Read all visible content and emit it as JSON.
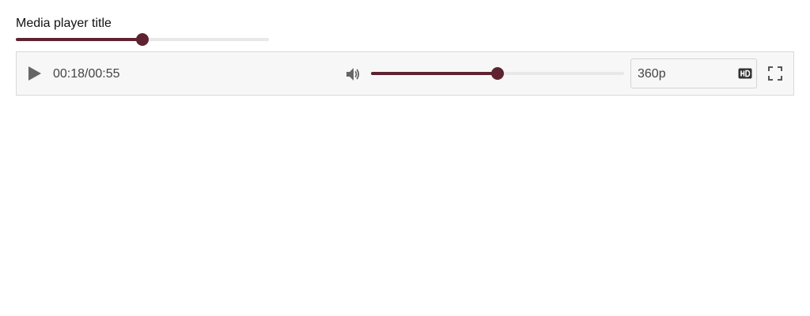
{
  "title": "Media player title",
  "colors": {
    "accent": "#5e2230",
    "track": "#e8e8e8",
    "icon": "#666666",
    "bar_bg": "#f7f7f7",
    "border": "#d9d9d9"
  },
  "seek": {
    "value": 0.5
  },
  "player": {
    "play_icon": "play-icon",
    "current_time": "00:18",
    "separator": "/",
    "duration": "00:55",
    "volume_icon": "volume-icon",
    "volume": {
      "value": 0.5
    },
    "quality": {
      "value": "360p",
      "icon": "hd-icon"
    },
    "fullscreen_icon": "fullscreen-icon"
  }
}
